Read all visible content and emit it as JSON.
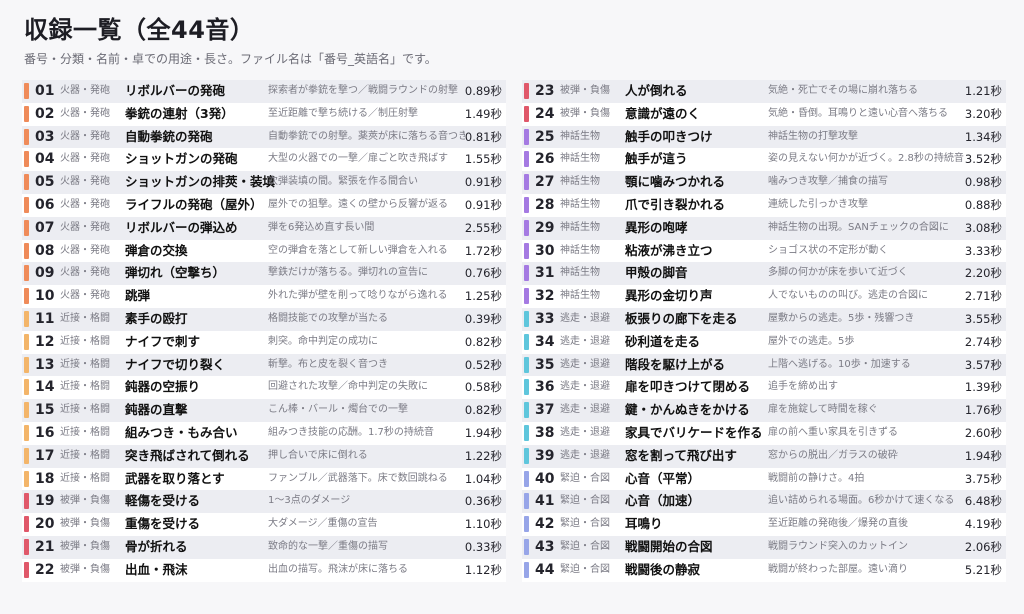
{
  "header": {
    "title": "収録一覧（全44音）",
    "subtitle": "番号・分類・名前・卓での用途・長さ。ファイル名は「番号_英語名」です。"
  },
  "category_colors": {
    "火器・発砲": "#ef8b5a",
    "近接・格闘": "#f3b56a",
    "被弾・負傷": "#e0586a",
    "神話生物": "#a57ae2",
    "逃走・退避": "#5fc6dc",
    "緊迫・合図": "#97a5e8"
  },
  "left_rows": [
    {
      "num": "01",
      "category": "火器・発砲",
      "name": "リボルバーの発砲",
      "use": "探索者が拳銃を撃つ／戦闘ラウンドの射撃",
      "length": "0.89秒"
    },
    {
      "num": "02",
      "category": "火器・発砲",
      "name": "拳銃の連射（3発）",
      "use": "至近距離で撃ち続ける／制圧射撃",
      "length": "1.49秒"
    },
    {
      "num": "03",
      "category": "火器・発砲",
      "name": "自動拳銃の発砲",
      "use": "自動拳銃での射撃。薬莢が床に落ちる音つき",
      "length": "0.81秒"
    },
    {
      "num": "04",
      "category": "火器・発砲",
      "name": "ショットガンの発砲",
      "use": "大型の火器での一撃／扉ごと吹き飛ばす",
      "length": "1.55秒"
    },
    {
      "num": "05",
      "category": "火器・発砲",
      "name": "ショットガンの排莢・装填",
      "use": "次弾装填の間。緊張を作る間合い",
      "length": "0.91秒"
    },
    {
      "num": "06",
      "category": "火器・発砲",
      "name": "ライフルの発砲（屋外）",
      "use": "屋外での狙撃。遠くの壁から反響が返る",
      "length": "0.91秒"
    },
    {
      "num": "07",
      "category": "火器・発砲",
      "name": "リボルバーの弾込め",
      "use": "弾を6発込め直す長い間",
      "length": "2.55秒"
    },
    {
      "num": "08",
      "category": "火器・発砲",
      "name": "弾倉の交換",
      "use": "空の弾倉を落として新しい弾倉を入れる",
      "length": "1.72秒"
    },
    {
      "num": "09",
      "category": "火器・発砲",
      "name": "弾切れ（空撃ち）",
      "use": "撃鉄だけが落ちる。弾切れの宣告に",
      "length": "0.76秒"
    },
    {
      "num": "10",
      "category": "火器・発砲",
      "name": "跳弾",
      "use": "外れた弾が壁を削って唸りながら逸れる",
      "length": "1.25秒"
    },
    {
      "num": "11",
      "category": "近接・格闘",
      "name": "素手の殴打",
      "use": "格闘技能での攻撃が当たる",
      "length": "0.39秒"
    },
    {
      "num": "12",
      "category": "近接・格闘",
      "name": "ナイフで刺す",
      "use": "刺突。命中判定の成功に",
      "length": "0.82秒"
    },
    {
      "num": "13",
      "category": "近接・格闘",
      "name": "ナイフで切り裂く",
      "use": "斬撃。布と皮を裂く音つき",
      "length": "0.52秒"
    },
    {
      "num": "14",
      "category": "近接・格闘",
      "name": "鈍器の空振り",
      "use": "回避された攻撃／命中判定の失敗に",
      "length": "0.58秒"
    },
    {
      "num": "15",
      "category": "近接・格闘",
      "name": "鈍器の直撃",
      "use": "こん棒・バール・燭台での一撃",
      "length": "0.82秒"
    },
    {
      "num": "16",
      "category": "近接・格闘",
      "name": "組みつき・もみ合い",
      "use": "組みつき技能の応酬。1.7秒の持続音",
      "length": "1.94秒"
    },
    {
      "num": "17",
      "category": "近接・格闘",
      "name": "突き飛ばされて倒れる",
      "use": "押し合いで床に倒れる",
      "length": "1.22秒"
    },
    {
      "num": "18",
      "category": "近接・格闘",
      "name": "武器を取り落とす",
      "use": "ファンブル／武器落下。床で数回跳ねる",
      "length": "1.04秒"
    },
    {
      "num": "19",
      "category": "被弾・負傷",
      "name": "軽傷を受ける",
      "use": "1〜3点のダメージ",
      "length": "0.36秒"
    },
    {
      "num": "20",
      "category": "被弾・負傷",
      "name": "重傷を受ける",
      "use": "大ダメージ／重傷の宣告",
      "length": "1.10秒"
    },
    {
      "num": "21",
      "category": "被弾・負傷",
      "name": "骨が折れる",
      "use": "致命的な一撃／重傷の描写",
      "length": "0.33秒"
    },
    {
      "num": "22",
      "category": "被弾・負傷",
      "name": "出血・飛沫",
      "use": "出血の描写。飛沫が床に落ちる",
      "length": "1.12秒"
    }
  ],
  "right_rows": [
    {
      "num": "23",
      "category": "被弾・負傷",
      "name": "人が倒れる",
      "use": "気絶・死亡でその場に崩れ落ちる",
      "length": "1.21秒"
    },
    {
      "num": "24",
      "category": "被弾・負傷",
      "name": "意識が遠のく",
      "use": "気絶・昏倒。耳鳴りと遠い心音へ落ちる",
      "length": "3.20秒"
    },
    {
      "num": "25",
      "category": "神話生物",
      "name": "触手の叩きつけ",
      "use": "神話生物の打撃攻撃",
      "length": "1.34秒"
    },
    {
      "num": "26",
      "category": "神話生物",
      "name": "触手が這う",
      "use": "姿の見えない何かが近づく。2.8秒の持続音",
      "length": "3.52秒"
    },
    {
      "num": "27",
      "category": "神話生物",
      "name": "顎に噛みつかれる",
      "use": "噛みつき攻撃／捕食の描写",
      "length": "0.98秒"
    },
    {
      "num": "28",
      "category": "神話生物",
      "name": "爪で引き裂かれる",
      "use": "連続した引っかき攻撃",
      "length": "0.88秒"
    },
    {
      "num": "29",
      "category": "神話生物",
      "name": "異形の咆哮",
      "use": "神話生物の出現。SANチェックの合図に",
      "length": "3.08秒"
    },
    {
      "num": "30",
      "category": "神話生物",
      "name": "粘液が沸き立つ",
      "use": "ショゴス状の不定形が動く",
      "length": "3.33秒"
    },
    {
      "num": "31",
      "category": "神話生物",
      "name": "甲殻の脚音",
      "use": "多脚の何かが床を歩いて近づく",
      "length": "2.20秒"
    },
    {
      "num": "32",
      "category": "神話生物",
      "name": "異形の金切り声",
      "use": "人でないものの叫び。逃走の合図に",
      "length": "2.71秒"
    },
    {
      "num": "33",
      "category": "逃走・退避",
      "name": "板張りの廊下を走る",
      "use": "屋敷からの逃走。5歩・残響つき",
      "length": "3.55秒"
    },
    {
      "num": "34",
      "category": "逃走・退避",
      "name": "砂利道を走る",
      "use": "屋外での逃走。5歩",
      "length": "2.74秒"
    },
    {
      "num": "35",
      "category": "逃走・退避",
      "name": "階段を駆け上がる",
      "use": "上階へ逃げる。10歩・加速する",
      "length": "3.57秒"
    },
    {
      "num": "36",
      "category": "逃走・退避",
      "name": "扉を叩きつけて閉める",
      "use": "追手を締め出す",
      "length": "1.39秒"
    },
    {
      "num": "37",
      "category": "逃走・退避",
      "name": "鍵・かんぬきをかける",
      "use": "扉を施錠して時間を稼ぐ",
      "length": "1.76秒"
    },
    {
      "num": "38",
      "category": "逃走・退避",
      "name": "家具でバリケードを作る",
      "use": "扉の前へ重い家具を引きずる",
      "length": "2.60秒"
    },
    {
      "num": "39",
      "category": "逃走・退避",
      "name": "窓を割って飛び出す",
      "use": "窓からの脱出／ガラスの破砕",
      "length": "1.94秒"
    },
    {
      "num": "40",
      "category": "緊迫・合図",
      "name": "心音（平常）",
      "use": "戦闘前の静けさ。4拍",
      "length": "3.75秒"
    },
    {
      "num": "41",
      "category": "緊迫・合図",
      "name": "心音（加速）",
      "use": "追い詰められる場面。6秒かけて速くなる",
      "length": "6.48秒"
    },
    {
      "num": "42",
      "category": "緊迫・合図",
      "name": "耳鳴り",
      "use": "至近距離の発砲後／爆発の直後",
      "length": "4.19秒"
    },
    {
      "num": "43",
      "category": "緊迫・合図",
      "name": "戦闘開始の合図",
      "use": "戦闘ラウンド突入のカットイン",
      "length": "2.06秒"
    },
    {
      "num": "44",
      "category": "緊迫・合図",
      "name": "戦闘後の静寂",
      "use": "戦闘が終わった部屋。遠い滴り",
      "length": "5.21秒"
    }
  ]
}
